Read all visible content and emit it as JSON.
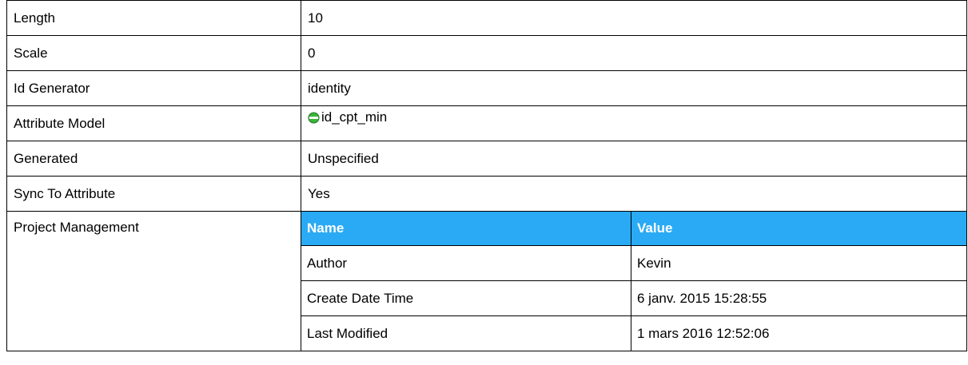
{
  "properties": [
    {
      "label": "Length",
      "value": "10"
    },
    {
      "label": "Scale",
      "value": "0"
    },
    {
      "label": "Id Generator",
      "value": "identity"
    },
    {
      "label": "Attribute Model",
      "value": "id_cpt_min",
      "icon": "attribute-icon"
    },
    {
      "label": "Generated",
      "value": "Unspecified"
    },
    {
      "label": "Sync To Attribute",
      "value": "Yes"
    }
  ],
  "project_management": {
    "label": "Project Management",
    "headers": {
      "name": "Name",
      "value": "Value"
    },
    "rows": [
      {
        "name": "Author",
        "value": "Kevin"
      },
      {
        "name": "Create Date Time",
        "value": "6 janv. 2015 15:28:55"
      },
      {
        "name": "Last Modified",
        "value": "1 mars 2016 12:52:06"
      }
    ]
  },
  "colors": {
    "header_bg": "#2aaaf5",
    "header_text": "#ffffff",
    "border": "#000000",
    "icon_green": "#3cb43c"
  }
}
